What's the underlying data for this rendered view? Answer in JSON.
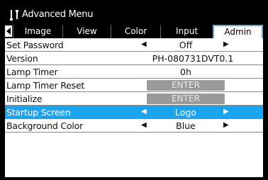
{
  "window": {
    "title": "Advanced Menu",
    "icon": "wrench-screwdriver-icon"
  },
  "tabs": {
    "prev_icon": "triangle-left-icon",
    "items": [
      {
        "label": "Image"
      },
      {
        "label": "View"
      },
      {
        "label": "Color"
      },
      {
        "label": "Input"
      },
      {
        "label": "Admin",
        "active": true
      }
    ]
  },
  "rows": {
    "set_password": {
      "label": "Set Password",
      "value": "Off",
      "left": "◀",
      "right": "▶"
    },
    "version": {
      "label": "Version",
      "value": "PH-080731DVT0.1"
    },
    "lamp_timer": {
      "label": "Lamp Timer",
      "value": "0h"
    },
    "lamp_timer_reset": {
      "label": "Lamp Timer Reset",
      "button": "ENTER"
    },
    "initialize": {
      "label": "Initialize",
      "button": "ENTER"
    },
    "startup_screen": {
      "label": "Startup Screen",
      "value": "Logo",
      "left": "◀",
      "right": "▶",
      "selected": true
    },
    "background_color": {
      "label": "Background Color",
      "value": "Blue",
      "left": "◀",
      "right": "▶"
    }
  },
  "colors": {
    "selection": "#1aa3ef",
    "tab_active_border": "#6fa5d8",
    "button": "#9a9a9a"
  }
}
